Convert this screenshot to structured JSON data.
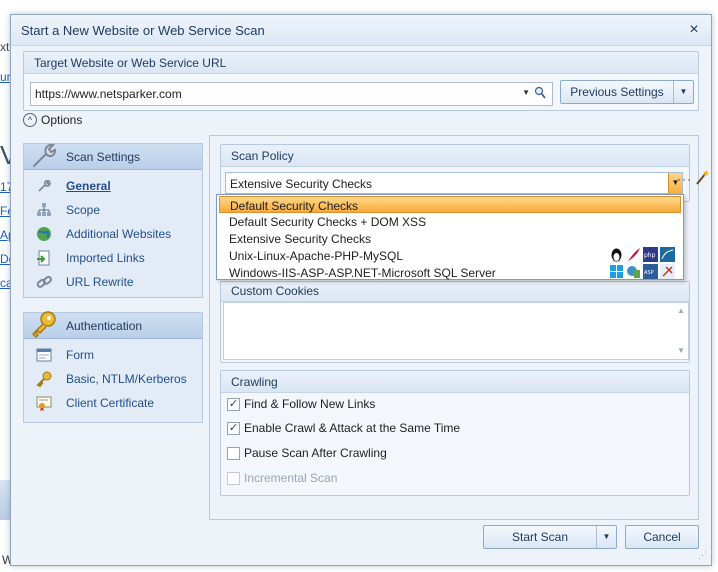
{
  "background": {
    "partial_texts": [
      "xt",
      "ur",
      "V",
      "17",
      "Fe",
      "Ap",
      "De",
      "ca",
      "ur"
    ],
    "page_tail_text": "Wh"
  },
  "dialog": {
    "title": "Start a New Website or Web Service Scan",
    "close_glyph": "×"
  },
  "target": {
    "group_title": "Target Website or Web Service URL",
    "url_value": "https://www.netsparker.com",
    "previous_settings_label": "Previous Settings"
  },
  "options": {
    "label": "Options",
    "toggle_glyph": "^"
  },
  "nav": {
    "scan_settings_title": "Scan Settings",
    "scan_settings_items": [
      {
        "label": "General",
        "icon": "wrench-icon"
      },
      {
        "label": "Scope",
        "icon": "sitemap-icon"
      },
      {
        "label": "Additional Websites",
        "icon": "globe-icon"
      },
      {
        "label": "Imported Links",
        "icon": "import-icon"
      },
      {
        "label": "URL Rewrite",
        "icon": "link-icon"
      }
    ],
    "authentication_title": "Authentication",
    "authentication_items": [
      {
        "label": "Form",
        "icon": "form-icon"
      },
      {
        "label": "Basic, NTLM/Kerberos",
        "icon": "key-icon"
      },
      {
        "label": "Client Certificate",
        "icon": "certificate-icon"
      }
    ]
  },
  "scan_policy": {
    "group_title": "Scan Policy",
    "selected": "Extensive Security Checks",
    "options": [
      {
        "label": "Default Security Checks",
        "highlighted": true
      },
      {
        "label": "Default Security Checks + DOM XSS"
      },
      {
        "label": "Extensive Security Checks"
      },
      {
        "label": "Unix-Linux-Apache-PHP-MySQL",
        "icons": [
          "linux-icon",
          "feather-icon",
          "php-icon",
          "mysql-icon"
        ]
      },
      {
        "label": "Windows-IIS-ASP-ASP.NET-Microsoft SQL Server",
        "icons": [
          "windows-icon",
          "iis-icon",
          "aspnet-icon",
          "sqlserver-icon"
        ]
      }
    ],
    "more_glyph": "···"
  },
  "custom_cookies": {
    "group_title": "Custom Cookies",
    "value": ""
  },
  "crawling": {
    "group_title": "Crawling",
    "options": [
      {
        "label": "Find & Follow New Links",
        "checked": true,
        "enabled": true
      },
      {
        "label": "Enable Crawl & Attack at the Same Time",
        "checked": true,
        "enabled": true
      },
      {
        "label": "Pause Scan After Crawling",
        "checked": false,
        "enabled": true
      },
      {
        "label": "Incremental Scan",
        "checked": false,
        "enabled": false
      }
    ]
  },
  "footer": {
    "start_scan_label": "Start Scan",
    "cancel_label": "Cancel"
  },
  "colors": {
    "accent": "#f5b042",
    "panel": "#eef3fa",
    "link": "#1f4f8f"
  }
}
